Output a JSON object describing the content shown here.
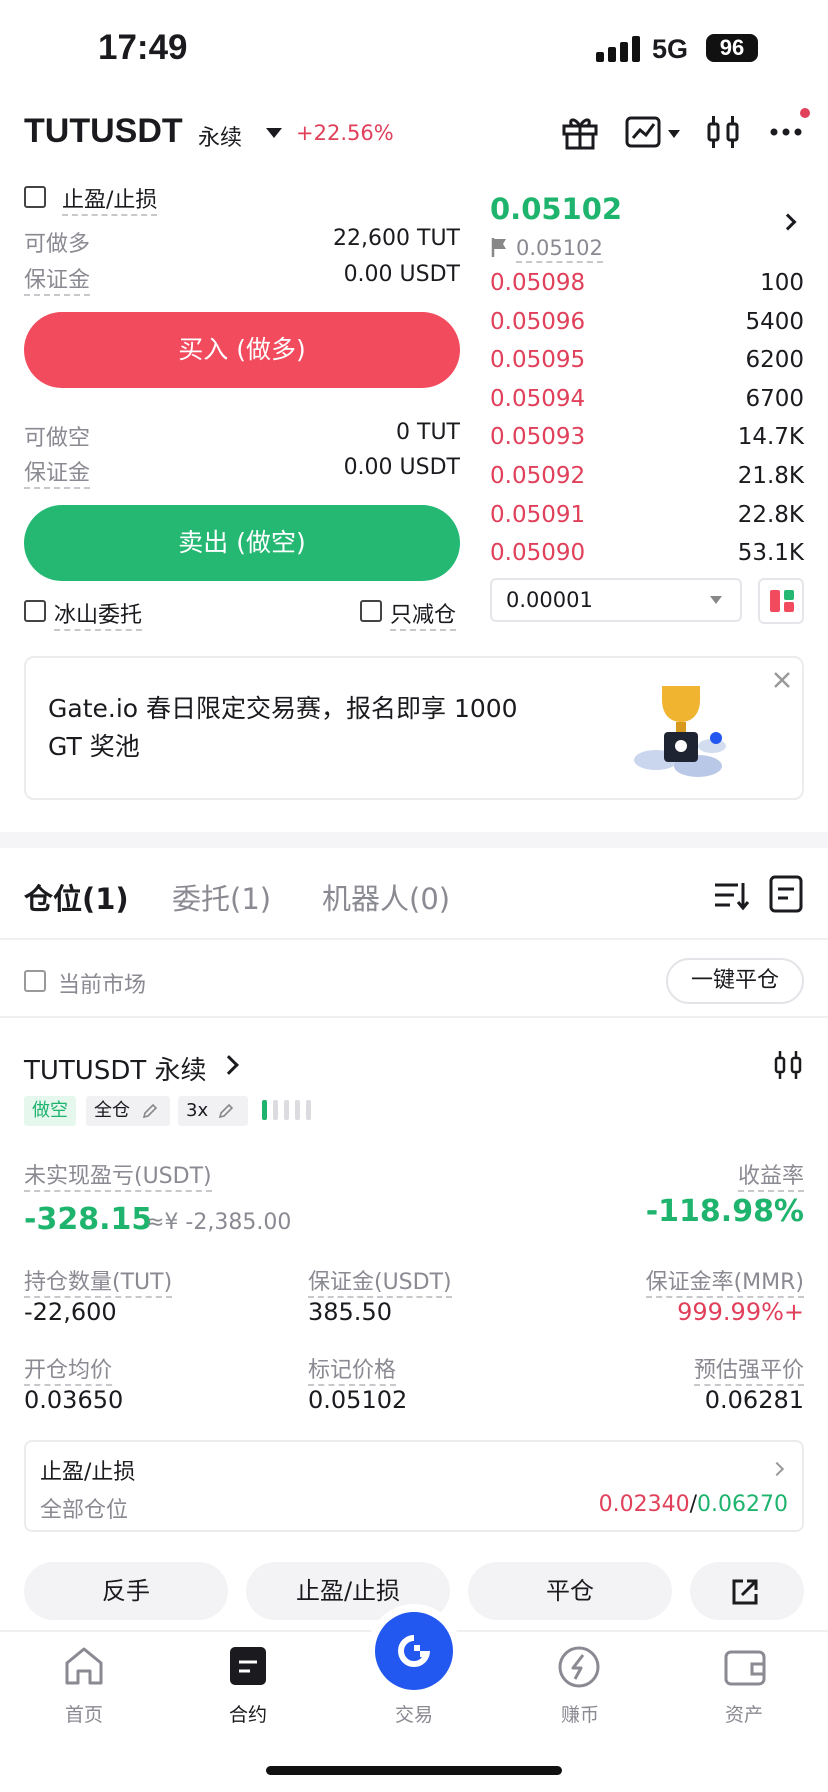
{
  "status_bar": {
    "time": "17:49",
    "network": "5G",
    "battery": "96"
  },
  "header": {
    "symbol": "TUTUSDT",
    "contract_type": "永续",
    "change": "+22.56%"
  },
  "order_form": {
    "tpsl_label": "止盈/止损",
    "long_available_label": "可做多",
    "long_available_value": "22,600 TUT",
    "margin_label": "保证金",
    "long_margin_value": "0.00 USDT",
    "buy_button": "买入 (做多)",
    "short_available_label": "可做空",
    "short_available_value": "0 TUT",
    "short_margin_value": "0.00 USDT",
    "sell_button": "卖出 (做空)",
    "iceberg_label": "冰山委托",
    "reduce_only_label": "只减仓"
  },
  "order_book": {
    "last_price": "0.05102",
    "mark_price": "0.05102",
    "asks": [
      {
        "price": "0.05098",
        "size": "100"
      },
      {
        "price": "0.05096",
        "size": "5400"
      },
      {
        "price": "0.05095",
        "size": "6200"
      },
      {
        "price": "0.05094",
        "size": "6700"
      },
      {
        "price": "0.05093",
        "size": "14.7K"
      },
      {
        "price": "0.05092",
        "size": "21.8K"
      },
      {
        "price": "0.05091",
        "size": "22.8K"
      },
      {
        "price": "0.05090",
        "size": "53.1K"
      }
    ],
    "tick_size": "0.00001"
  },
  "banner": {
    "text": "Gate.io 春日限定交易赛，报名即享 1000 GT 奖池"
  },
  "tabs": [
    {
      "label": "仓位(1)"
    },
    {
      "label": "委托(1)"
    },
    {
      "label": "机器人(0)"
    }
  ],
  "filter": {
    "current_market_label": "当前市场",
    "close_all_button": "一键平仓"
  },
  "position": {
    "title": "TUTUSDT 永续",
    "side_tag": "做空",
    "margin_mode_tag": "全仓",
    "leverage_tag": "3x",
    "risk_level": 0.2,
    "unrealized_pnl_label": "未实现盈亏(USDT)",
    "unrealized_pnl": "-328.15",
    "unrealized_pnl_cny": "≈¥ -2,385.00",
    "roi_label": "收益率",
    "roi": "-118.98%",
    "size_label": "持仓数量(TUT)",
    "size": "-22,600",
    "margin_label": "保证金(USDT)",
    "margin": "385.50",
    "mmr_label": "保证金率(MMR)",
    "mmr": "999.99%+",
    "entry_label": "开仓均价",
    "entry": "0.03650",
    "mark_label": "标记价格",
    "mark": "0.05102",
    "liq_label": "预估强平价",
    "liq": "0.06281",
    "tpsl_title": "止盈/止损",
    "tpsl_scope": "全部仓位",
    "tp_price": "0.02340",
    "sl_price": "0.06270",
    "tpsl_sep": "/"
  },
  "actions": {
    "reverse": "反手",
    "tpsl": "止盈/止损",
    "close": "平仓"
  },
  "bottom_nav": [
    {
      "label": "首页",
      "icon": "home-icon"
    },
    {
      "label": "合约",
      "icon": "contract-icon"
    },
    {
      "label": "交易",
      "icon": "trade-icon"
    },
    {
      "label": "赚币",
      "icon": "earn-icon"
    },
    {
      "label": "资产",
      "icon": "wallet-icon"
    }
  ],
  "colors": {
    "red": "#e0405a",
    "green": "#1fb46d",
    "buy": "#f24b5e",
    "sell": "#24b873",
    "accent": "#2257f0"
  }
}
